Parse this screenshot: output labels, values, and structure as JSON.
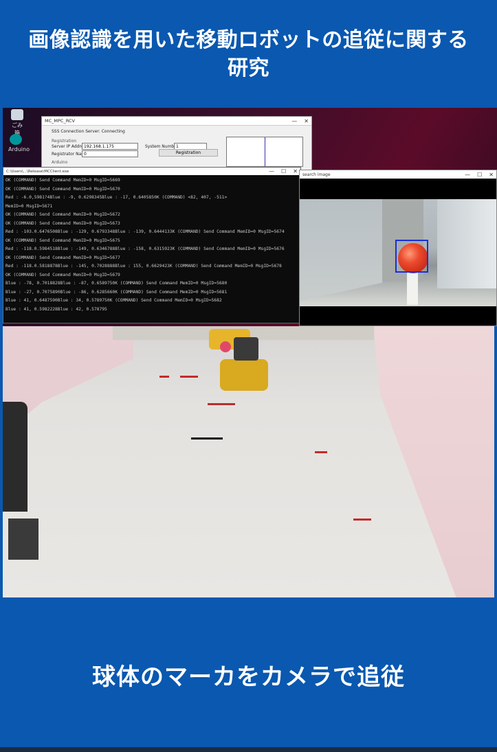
{
  "header": {
    "title_line1": "画像認識を用いた移動ロボットの追従に関する",
    "title_line2": "研究"
  },
  "desktop": {
    "icons": [
      {
        "label": "ごみ箱"
      },
      {
        "label": "Arduino"
      }
    ]
  },
  "dialog": {
    "title": "MC_MPC_RCV",
    "status": "SSS Connection Server: Connecting",
    "group_registration": "Registration",
    "server_ip_label": "Server IP Address",
    "server_ip_value": "192.168.1.175",
    "system_number_label": "System Number",
    "system_number_value": "1",
    "registrator_label": "Registrator Name:",
    "registrator_value": "0",
    "registration_button": "Registration",
    "group_arduino": "Arduino"
  },
  "console": {
    "title": "C:\\Users\\...\\Release\\MCClient.exe",
    "lines": [
      "OK (COMMAND) Send Command MemID=0 MsgID=5669",
      "OK (COMMAND) Send Command MemID=0 MsgID=5670",
      "Red  : -6.0,5981?4Blue : -9, 0.6298345Blue : -17, 0.6405850K (COMMAND) <82, 407, -511>",
      " MemID=0 MsgID=5671",
      "OK (COMMAND) Send Command MemID=0 MsgID=5672",
      "OK (COMMAND) Send Command MemID=0 MsgID=5673",
      "Red  : -103.0.6476508Blue : -129, 0.6793348Blue : -139, 0.6444133K (COMMAND) Send Command MemID=0 MsgID=5674",
      "OK (COMMAND) Send Command MemID=0 MsgID=5675",
      "Red  : -118.0.5984518Blue : -149, 0.6346788Blue : -158, 0.6315923K (COMMAND) Send Command MemID=0 MsgID=5676",
      "OK (COMMAND) Send Command MemID=0 MsgID=5677",
      "Red  : -118.0.5818878Blue : -145, 0.7028888Blue : 155, 0.6629423K (COMMAND) Send Command MemID=0 MsgID=5678",
      "OK (COMMAND) Send Command MemID=0 MsgID=5679",
      "Blue : -78, 0.7018828Blue : -87, 0.6589750K (COMMAND) Send Command MemID=0 MsgID=5680",
      "Blue : -27, 0.7075890Blue : -86, 0.6285660K (COMMAND) Send Command MemID=0 MsgID=5681",
      "Blue : 41, 0.6487590Blue : 34, 0.5789750K (COMMAND) Send Command MemID=0 MsgID=5682",
      "Blue : 41, 0.5982228Blue : 42, 0.578795"
    ]
  },
  "search_window": {
    "title": "search image"
  },
  "footer": {
    "caption": "球体のマーカをカメラで追従"
  },
  "colors": {
    "banner_blue": "#0a58b0",
    "bbox_blue": "#1b2ed6",
    "ball_red": "#ec4a2d"
  }
}
